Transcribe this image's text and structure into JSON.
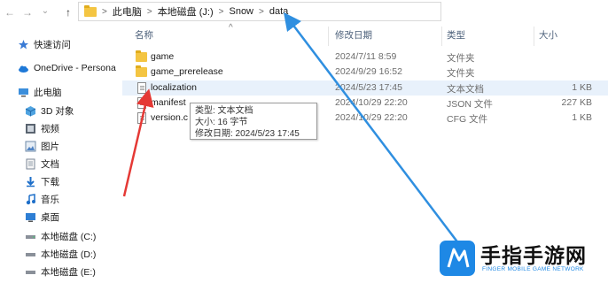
{
  "address_bar": {
    "nav_back": "←",
    "nav_forward": "→",
    "nav_recent": "⌄",
    "nav_up": "↑",
    "crumbs": [
      "此电脑",
      "本地磁盘 (J:)",
      "Snow",
      "data"
    ],
    "separator": ">"
  },
  "sidebar": {
    "items": [
      {
        "label": "快速访问",
        "icon": "star-icon"
      },
      {
        "label": "OneDrive - Persona",
        "icon": "cloud-icon"
      },
      {
        "label": "此电脑",
        "icon": "computer-icon"
      },
      {
        "label": "3D 对象",
        "icon": "cube-icon"
      },
      {
        "label": "视频",
        "icon": "video-icon"
      },
      {
        "label": "图片",
        "icon": "picture-icon"
      },
      {
        "label": "文档",
        "icon": "document-icon"
      },
      {
        "label": "下载",
        "icon": "download-icon"
      },
      {
        "label": "音乐",
        "icon": "music-icon"
      },
      {
        "label": "桌面",
        "icon": "desktop-icon"
      },
      {
        "label": "本地磁盘 (C:)",
        "icon": "drive-icon"
      },
      {
        "label": "本地磁盘 (D:)",
        "icon": "drive-icon"
      },
      {
        "label": "本地磁盘 (E:)",
        "icon": "drive-icon"
      }
    ]
  },
  "columns": {
    "name": "名称",
    "date": "修改日期",
    "type": "类型",
    "size": "大小",
    "sort_indicator": "^"
  },
  "files": [
    {
      "name": "game",
      "date": "2024/7/11 8:59",
      "type": "文件夹",
      "size": "",
      "icon": "folder-icon"
    },
    {
      "name": "game_prerelease",
      "date": "2024/9/29 16:52",
      "type": "文件夹",
      "size": "",
      "icon": "folder-icon"
    },
    {
      "name": "localization",
      "date": "2024/5/23 17:45",
      "type": "文本文档",
      "size": "1 KB",
      "icon": "text-file-icon"
    },
    {
      "name": "manifest",
      "date": "2024/10/29 22:20",
      "type": "JSON 文件",
      "size": "227 KB",
      "icon": "file-icon"
    },
    {
      "name": "version.c",
      "date": "2024/10/29 22:20",
      "type": "CFG 文件",
      "size": "1 KB",
      "icon": "file-icon"
    }
  ],
  "tooltip": {
    "type_line": "类型: 文本文档",
    "size_line": "大小: 16 字节",
    "date_line": "修改日期: 2024/5/23 17:45"
  },
  "watermark": {
    "title": "手指手游网",
    "subtitle": "FINGER MOBILE GAME NETWORK"
  },
  "colors": {
    "selection": "#e8f1fb",
    "folder": "#f4c542",
    "red_arrow": "#e53935",
    "blue_arrow": "#2f8fe0"
  }
}
